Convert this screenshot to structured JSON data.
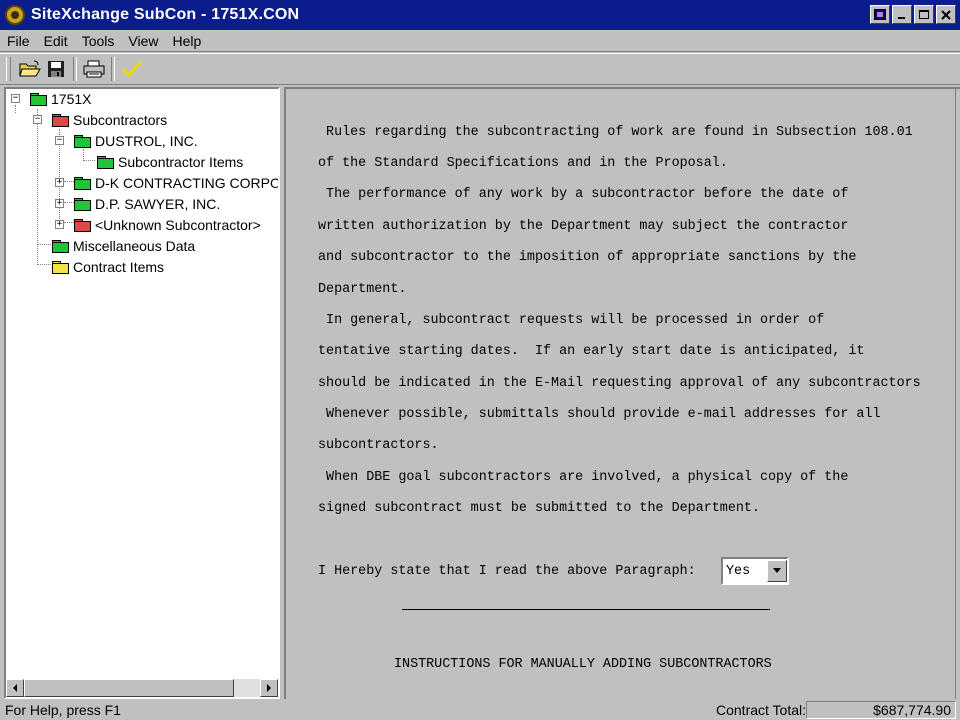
{
  "window": {
    "title": "SiteXchange SubCon - 1751X.CON"
  },
  "menu": [
    "File",
    "Edit",
    "Tools",
    "View",
    "Help"
  ],
  "toolbar": {
    "icons": [
      "open-folder-icon",
      "save-icon",
      "print-icon",
      "check-icon"
    ]
  },
  "tree": {
    "root": "1751X",
    "subcontractors": "Subcontractors",
    "dustrol": "DUSTROL, INC.",
    "sub_items": "Subcontractor Items",
    "dk": "D-K CONTRACTING CORPOR/",
    "dp": "D.P. SAWYER, INC.",
    "unknown": "<Unknown Subcontractor>",
    "misc": "Miscellaneous Data",
    "contract_items": "Contract Items"
  },
  "content": {
    "lines": [
      " Rules regarding the subcontracting of work are found in Subsection 108.01",
      "of the Standard Specifications and in the Proposal.",
      " The performance of any work by a subcontractor before the date of",
      "written authorization by the Department may subject the contractor",
      "and subcontractor to the imposition of appropriate sanctions by the",
      "Department.",
      " In general, subcontract requests will be processed in order of",
      "tentative starting dates.  If an early start date is anticipated, it",
      "should be indicated in the E-Mail requesting approval of any subcontractors",
      " Whenever possible, submittals should provide e-mail addresses for all",
      "subcontractors.",
      " When DBE goal subcontractors are involved, a physical copy of the",
      "signed subcontract must be submitted to the Department."
    ],
    "statement": "I Hereby state that I read the above Paragraph:",
    "read_confirm": "Yes",
    "instructions_heading": "INSTRUCTIONS FOR MANUALLY ADDING SUBCONTRACTORS"
  },
  "status": {
    "help": "For Help, press F1",
    "total_label": "Contract Total:",
    "total_value": "$687,774.90"
  },
  "colors": {
    "titlebar": "#0a1d8a",
    "folder_green": "#22c33a",
    "folder_red": "#e04848",
    "folder_yellow": "#f4e24a"
  }
}
